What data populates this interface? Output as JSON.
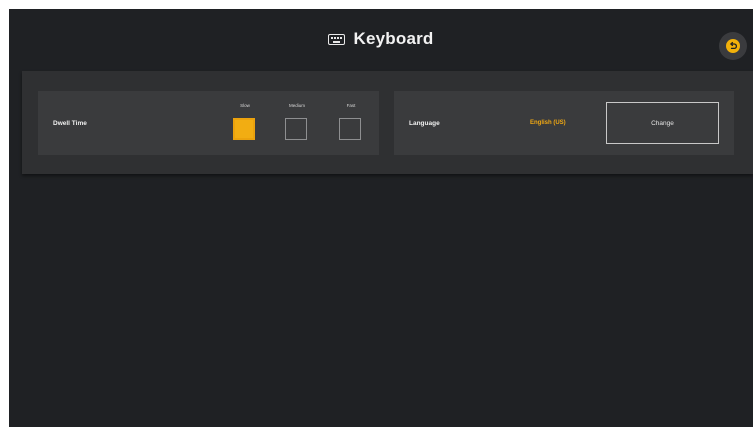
{
  "header": {
    "title": "Keyboard",
    "title_icon": "keyboard-icon",
    "back_icon": "back-arrow-icon"
  },
  "dwell_time": {
    "label": "Dwell Time",
    "options": [
      {
        "label": "Slow",
        "selected": true
      },
      {
        "label": "Medium",
        "selected": false
      },
      {
        "label": "Fast",
        "selected": false
      }
    ]
  },
  "language": {
    "label": "Language",
    "value": "English (US)",
    "change_label": "Change"
  },
  "colors": {
    "accent": "#f2ad12",
    "background": "#1f2124",
    "panel": "#2f3032",
    "card": "#3a3b3d"
  }
}
